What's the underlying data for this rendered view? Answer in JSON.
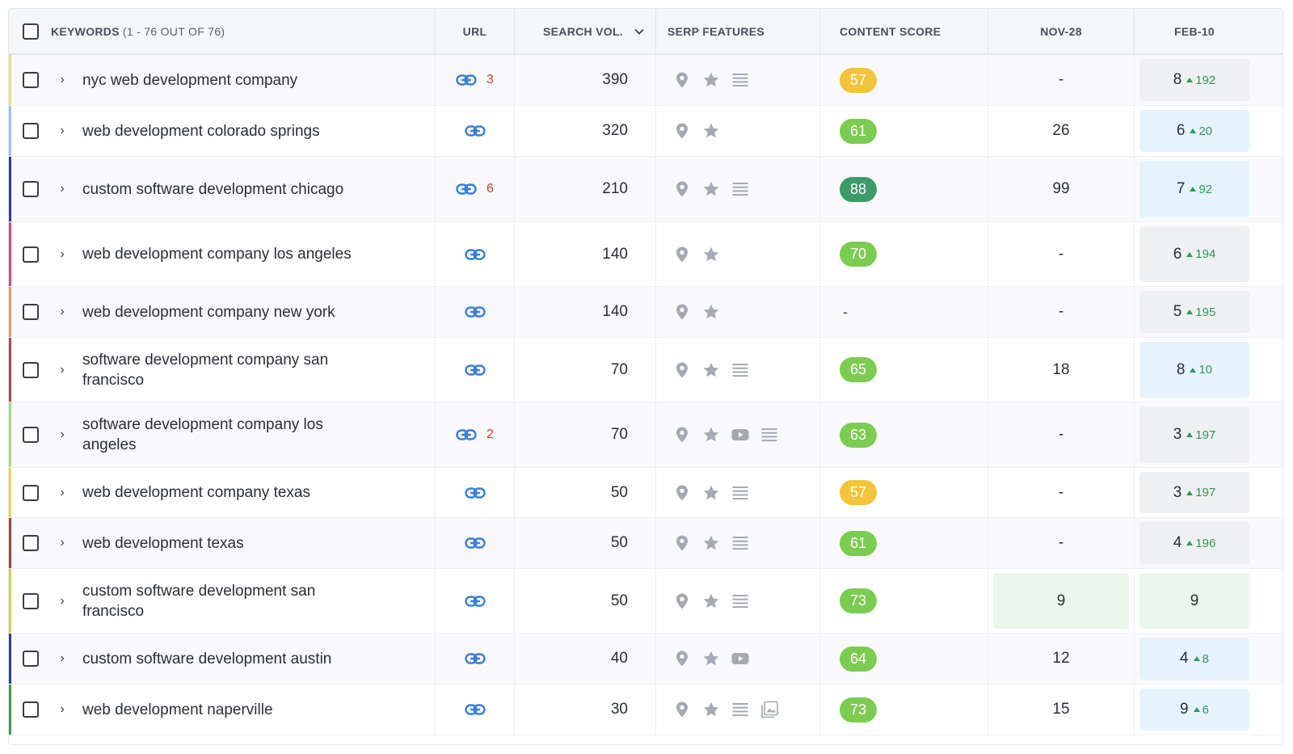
{
  "header": {
    "keywords_label": "KEYWORDS",
    "keywords_range": "(1 - 76 OUT OF 76)",
    "url": "URL",
    "search_vol": "SEARCH VOL.",
    "serp_features": "SERP FEATURES",
    "content_score": "CONTENT SCORE",
    "nov": "NOV-28",
    "feb": "FEB-10"
  },
  "colors": {
    "badge_yellow": "#f2c43c",
    "badge_light_green": "#7dcc52",
    "badge_dark_green": "#3d9b6a",
    "link_blue": "#3a7fd5",
    "serp_icon_gray": "#a6a9b2"
  },
  "rows": [
    {
      "keyword": "nyc web development company",
      "accent": "#e8d88a",
      "url_count": "3",
      "volume": "390",
      "serp": [
        "map-pin-icon",
        "star-icon",
        "list-icon"
      ],
      "score": "57",
      "score_color": "badge_yellow",
      "nov": "-",
      "nov_bg": "",
      "feb": "8",
      "feb_change": "192",
      "feb_bg": "gray"
    },
    {
      "keyword": "web development colorado springs",
      "accent": "#9ec3e8",
      "url_count": "",
      "volume": "320",
      "serp": [
        "map-pin-icon",
        "star-icon"
      ],
      "score": "61",
      "score_color": "badge_light_green",
      "nov": "26",
      "nov_bg": "",
      "feb": "6",
      "feb_change": "20",
      "feb_bg": "blue"
    },
    {
      "keyword": "custom software development chicago",
      "accent": "#2f3a8f",
      "url_count": "6",
      "volume": "210",
      "serp": [
        "map-pin-icon",
        "star-icon",
        "list-icon"
      ],
      "score": "88",
      "score_color": "badge_dark_green",
      "nov": "99",
      "nov_bg": "",
      "feb": "7",
      "feb_change": "92",
      "feb_bg": "blue"
    },
    {
      "keyword": "web development company los angeles",
      "accent": "#e0457d",
      "url_count": "",
      "volume": "140",
      "serp": [
        "map-pin-icon",
        "star-icon"
      ],
      "score": "70",
      "score_color": "badge_light_green",
      "nov": "-",
      "nov_bg": "",
      "feb": "6",
      "feb_change": "194",
      "feb_bg": "gray"
    },
    {
      "keyword": "web development company new york",
      "accent": "#d9a067",
      "url_count": "",
      "volume": "140",
      "serp": [
        "map-pin-icon",
        "star-icon"
      ],
      "score": "-",
      "score_color": "",
      "nov": "-",
      "nov_bg": "",
      "feb": "5",
      "feb_change": "195",
      "feb_bg": "gray"
    },
    {
      "keyword": "software development company san francisco",
      "accent": "#a04a4a",
      "url_count": "",
      "volume": "70",
      "serp": [
        "map-pin-icon",
        "star-icon",
        "list-icon"
      ],
      "score": "65",
      "score_color": "badge_light_green",
      "nov": "18",
      "nov_bg": "",
      "feb": "8",
      "feb_change": "10",
      "feb_bg": "blue"
    },
    {
      "keyword": "software development company los angeles",
      "accent": "#a8dc8c",
      "url_count": "2",
      "volume": "70",
      "serp": [
        "map-pin-icon",
        "star-icon",
        "video-icon",
        "list-icon"
      ],
      "score": "63",
      "score_color": "badge_light_green",
      "nov": "-",
      "nov_bg": "",
      "feb": "3",
      "feb_change": "197",
      "feb_bg": "gray"
    },
    {
      "keyword": "web development company texas",
      "accent": "#e8d64a",
      "url_count": "",
      "volume": "50",
      "serp": [
        "map-pin-icon",
        "star-icon",
        "list-icon"
      ],
      "score": "57",
      "score_color": "badge_yellow",
      "nov": "-",
      "nov_bg": "",
      "feb": "3",
      "feb_change": "197",
      "feb_bg": "gray"
    },
    {
      "keyword": "web development texas",
      "accent": "#b33a3a",
      "url_count": "",
      "volume": "50",
      "serp": [
        "map-pin-icon",
        "star-icon",
        "list-icon"
      ],
      "score": "61",
      "score_color": "badge_light_green",
      "nov": "-",
      "nov_bg": "",
      "feb": "4",
      "feb_change": "196",
      "feb_bg": "gray"
    },
    {
      "keyword": "custom software development san francisco",
      "accent": "#c9d64a",
      "url_count": "",
      "volume": "50",
      "serp": [
        "map-pin-icon",
        "star-icon",
        "list-icon"
      ],
      "score": "73",
      "score_color": "badge_light_green",
      "nov": "9",
      "nov_bg": "green",
      "feb": "9",
      "feb_change": "",
      "feb_bg": "green"
    },
    {
      "keyword": "custom software development austin",
      "accent": "#2a3f8c",
      "url_count": "",
      "volume": "40",
      "serp": [
        "map-pin-icon",
        "star-icon",
        "video-icon"
      ],
      "score": "64",
      "score_color": "badge_light_green",
      "nov": "12",
      "nov_bg": "",
      "feb": "4",
      "feb_change": "8",
      "feb_bg": "blue"
    },
    {
      "keyword": "web development naperville",
      "accent": "#3e9a4e",
      "url_count": "",
      "volume": "30",
      "serp": [
        "map-pin-icon",
        "star-icon",
        "list-icon",
        "image-icon"
      ],
      "score": "73",
      "score_color": "badge_light_green",
      "nov": "15",
      "nov_bg": "",
      "feb": "9",
      "feb_change": "6",
      "feb_bg": "blue"
    }
  ]
}
